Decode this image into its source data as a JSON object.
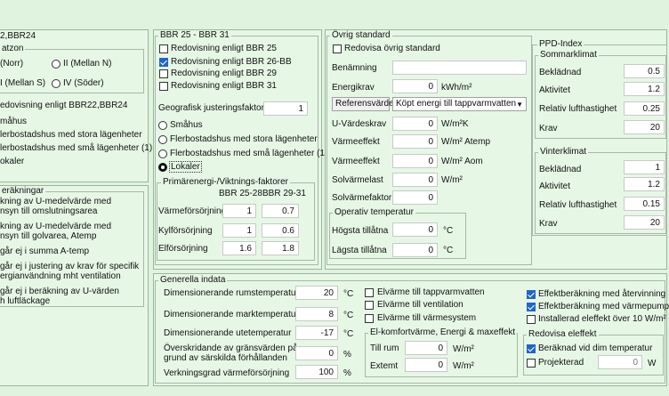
{
  "left": {
    "title": "2,BBR24",
    "zone_group": "atzon",
    "zone1": "(Norr)",
    "zone2": "II (Mellan N)",
    "zone3": "I (Mellan S)",
    "zone4": "IV (Söder)",
    "redov": "edovisning enligt BBR22,BBR24",
    "opt1": "måhus",
    "opt2": "lerbostadshus med stora lägenheter",
    "opt3": "lerbostadshus med små lägenheter (1)",
    "opt4": "okaler",
    "calc_group": "eräkningar",
    "c1a": "kning av U-medelvärde med",
    "c1b": "nsyn till omslutningsarea",
    "c2a": "kning av U-medelvärde med",
    "c2b": "nsyn till golvarea, Atemp",
    "c3": "går ej i summa A-temp",
    "c4a": "går ej i justering av krav för specifik",
    "c4b": "ergianvändning mht ventilation",
    "c5a": "går ej i beräkning av U-värden",
    "c5b": "h luftläckage"
  },
  "bbr": {
    "title": "BBR 25 - BBR 31",
    "cb1": "Redovisning enligt BBR 25",
    "cb2": "Redovisning enligt BBR 26-BBR 28",
    "cb3": "Redovisning enligt BBR 29",
    "cb4": "Redovisning enligt BBR 31",
    "geo_label": "Geografisk justeringsfaktor",
    "geo_value": "1",
    "r1": "Småhus",
    "r2": "Flerbostadshus med stora lägenheter",
    "r3": "Flerbostadshus med små lägenheter (1)",
    "r4": "Lokaler",
    "pe_title": "Primärenergi-/Viktnings-faktorer",
    "col1": "BBR 25-28",
    "col2": "BBR 29-31",
    "rows": [
      {
        "label": "Värmeförsörjning",
        "v1": "1",
        "v2": "0.7"
      },
      {
        "label": "Kylförsörjning",
        "v1": "1",
        "v2": "0.6"
      },
      {
        "label": "Elförsörjning",
        "v1": "1.6",
        "v2": "1.8"
      }
    ]
  },
  "ovrig": {
    "title": "Övrig standard",
    "redov": "Redovisa övrig standard",
    "benamning": "Benämning",
    "energikrav": "Energikrav",
    "energikrav_value": "0",
    "energikrav_unit": "kWh/m²",
    "ref_btn": "Referensvärde",
    "ref_select": "Köpt energi till tappvarmvatten",
    "rows": [
      {
        "label": "U-Värdeskrav",
        "value": "0",
        "unit": "W/m²K"
      },
      {
        "label": "Värmeeffekt",
        "value": "0",
        "unit": "W/m² Atemp"
      },
      {
        "label": "Värmeeffekt",
        "value": "0",
        "unit": "W/m² Aom"
      },
      {
        "label": "Solvärmelast",
        "value": "0",
        "unit": "W/m²"
      },
      {
        "label": "Solvärmefaktor",
        "value": "0",
        "unit": ""
      }
    ],
    "op_title": "Operativ temperatur",
    "hogsta": "Högsta tillåtna",
    "hogsta_value": "0",
    "lagsta": "Lägsta tillåtna",
    "lagsta_value": "0",
    "deg": "°C"
  },
  "ppd": {
    "title": "PPD-Index",
    "sommar": "Sommarklimat",
    "vinter": "Vinterklimat",
    "s_rows": [
      {
        "label": "Beklädnad",
        "value": "0.5"
      },
      {
        "label": "Aktivitet",
        "value": "1.2"
      },
      {
        "label": "Relativ lufthastighet",
        "value": "0.25"
      },
      {
        "label": "Krav",
        "value": "20"
      }
    ],
    "w_rows": [
      {
        "label": "Beklädnad",
        "value": "1"
      },
      {
        "label": "Aktivitet",
        "value": "1.2"
      },
      {
        "label": "Relativ lufthastighet",
        "value": "0.15"
      },
      {
        "label": "Krav",
        "value": "20"
      }
    ]
  },
  "gen": {
    "title": "Generella indata",
    "rows": [
      {
        "label": "Dimensionerande rumstemperatur",
        "value": "20",
        "unit": "°C"
      },
      {
        "label": "Dimensionerande marktemperatur",
        "value": "8",
        "unit": "°C"
      },
      {
        "label": "Dimensionerande utetemperatur",
        "value": "-17",
        "unit": "°C"
      }
    ],
    "over1": "Överskridande av gränsvärden på",
    "over2": "grund av särskilda förhållanden",
    "over_value": "0",
    "over_unit": "%",
    "verk": "Verkningsgrad värmeförsörjning",
    "verk_value": "100",
    "verk_unit": "%",
    "el1": "Elvärme till tappvarmvatten",
    "el2": "Elvärme till ventilation",
    "el3": "Elvärme till värmesystem",
    "elk_title": "El-komfortvärme, Energi & maxeffekt",
    "tillrum": "Till rum",
    "tillrum_value": "0",
    "extemt": "Extemt",
    "extemt_value": "0",
    "wm2": "W/m²",
    "eff1": "Effektberäkning med återvinning",
    "eff2": "Effektberäkning med värmepump",
    "eff3": "Installerad eleffekt över 10 W/m²",
    "redel_title": "Redovisa eleffekt",
    "redel1": "Beräknad vid dim temperatur",
    "redel2": "Projekterad",
    "redel2_value": "0",
    "redel2_unit": "W"
  }
}
